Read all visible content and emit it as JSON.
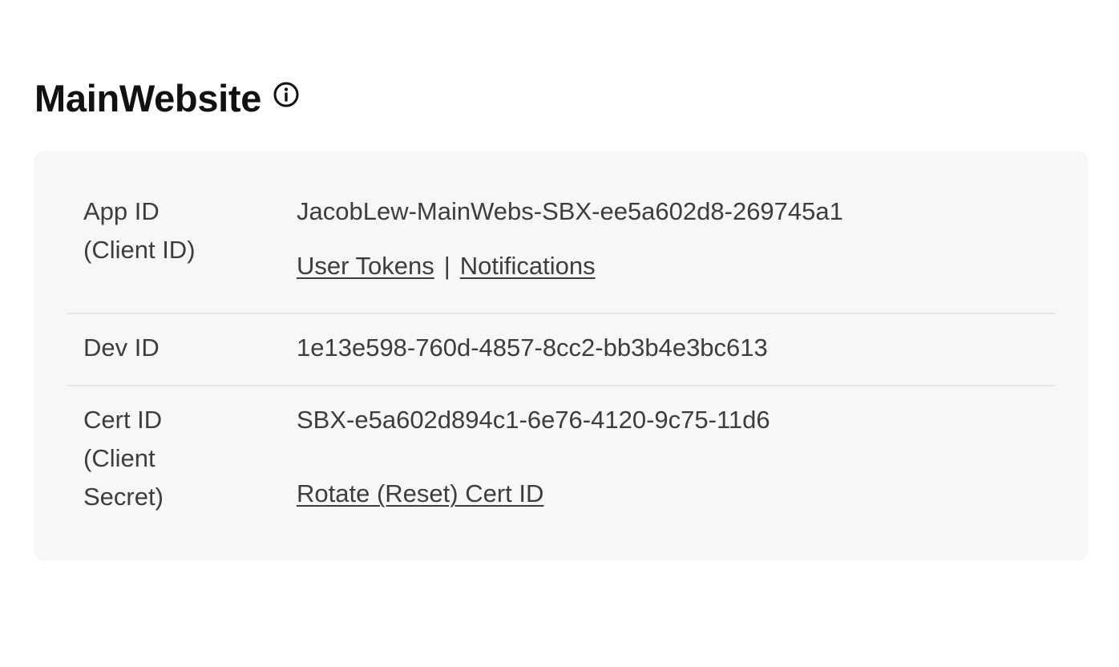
{
  "header": {
    "title": "MainWebsite",
    "info_icon": "info-circle-icon"
  },
  "credentials": {
    "app_id": {
      "label": "App ID\n(Client ID)",
      "value": "JacobLew-MainWebs-SBX-ee5a602d8-269745a1",
      "links": {
        "user_tokens": "User Tokens",
        "separator": "|",
        "notifications": "Notifications"
      }
    },
    "dev_id": {
      "label": "Dev ID",
      "value": "1e13e598-760d-4857-8cc2-bb3b4e3bc613"
    },
    "cert_id": {
      "label": "Cert ID\n(Client\nSecret)",
      "value": "SBX-e5a602d894c1-6e76-4120-9c75-11d6",
      "rotate_link": "Rotate (Reset) Cert ID"
    }
  },
  "colors": {
    "card_background": "#f7f7f7",
    "divider": "#e6e6e6",
    "title_text": "#111111",
    "body_text": "#3d3d3d"
  }
}
